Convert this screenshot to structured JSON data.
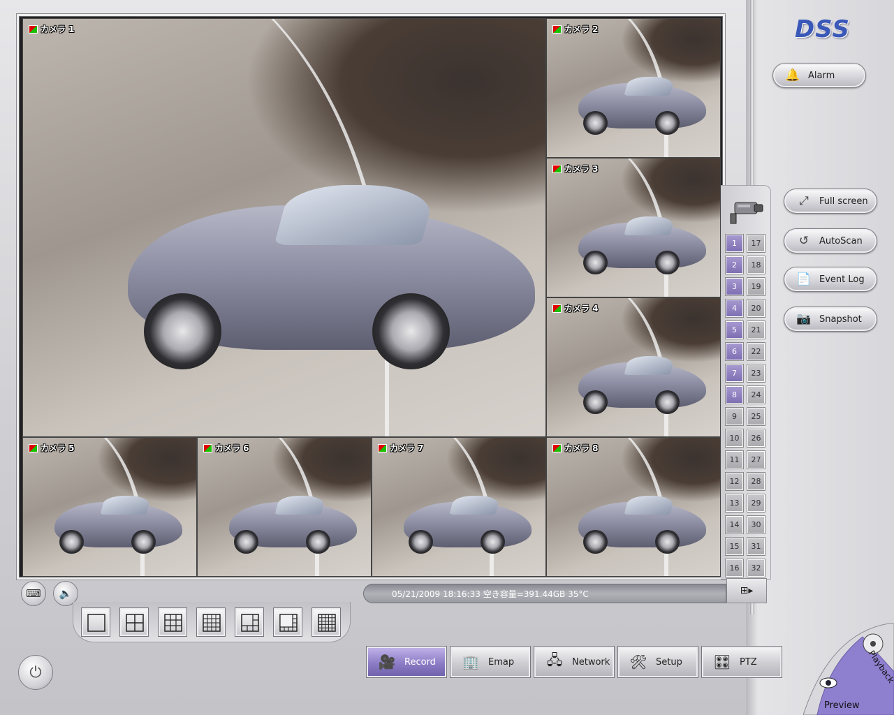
{
  "app": {
    "logo": "DSS"
  },
  "cameras": [
    {
      "label": "カメラ 1"
    },
    {
      "label": "カメラ 2"
    },
    {
      "label": "カメラ 3"
    },
    {
      "label": "カメラ 4"
    },
    {
      "label": "カメラ 5"
    },
    {
      "label": "カメラ 6"
    },
    {
      "label": "カメラ 7"
    },
    {
      "label": "カメラ 8"
    }
  ],
  "channels": {
    "left": [
      "1",
      "2",
      "3",
      "4",
      "5",
      "6",
      "7",
      "8",
      "9",
      "10",
      "11",
      "12",
      "13",
      "14",
      "15",
      "16"
    ],
    "right": [
      "17",
      "18",
      "19",
      "20",
      "21",
      "22",
      "23",
      "24",
      "25",
      "26",
      "27",
      "28",
      "29",
      "30",
      "31",
      "32"
    ],
    "active_count": 8,
    "active_color": "#8a7bbf"
  },
  "right_panel": {
    "alarm": "Alarm",
    "full_screen": "Full screen",
    "autoscan": "AutoScan",
    "event_log": "Event Log",
    "snapshot": "Snapshot"
  },
  "status": {
    "text": "05/21/2009 18:16:33  空き容量=391.44GB 35°C"
  },
  "bottom_tabs": {
    "record": "Record",
    "emap": "Emap",
    "network": "Network",
    "setup": "Setup",
    "ptz": "PTZ"
  },
  "corner": {
    "preview": "Preview",
    "playback": "Playback"
  }
}
